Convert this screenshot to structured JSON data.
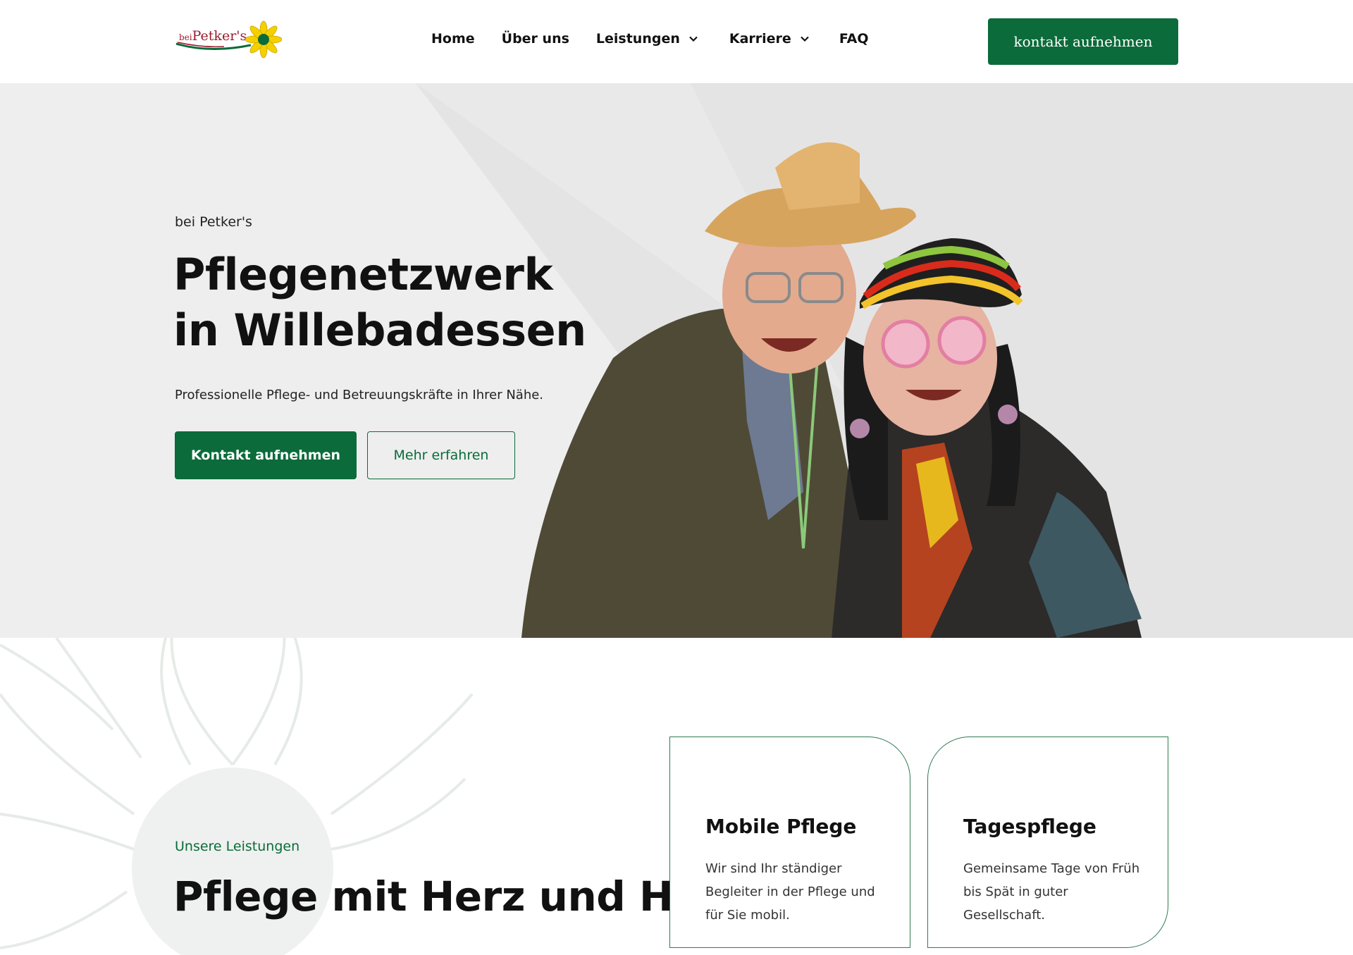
{
  "header": {
    "logo_text": "Petker's",
    "logo_small": "bei",
    "nav": [
      {
        "label": "Home",
        "has_dropdown": false
      },
      {
        "label": "Über uns",
        "has_dropdown": false
      },
      {
        "label": "Leistungen",
        "has_dropdown": true
      },
      {
        "label": "Karriere",
        "has_dropdown": true
      },
      {
        "label": "FAQ",
        "has_dropdown": false
      }
    ],
    "cta_label": "kontakt aufnehmen"
  },
  "hero": {
    "eyebrow": "bei Petker's",
    "title": "Pflegenetzwerk in Willebadessen",
    "subtitle": "Professionelle Pflege- und Betreuungskräfte in Ihrer Nähe.",
    "primary_button": "Kontakt aufnehmen",
    "secondary_button": "Mehr erfahren",
    "photo_icon": "elderly-couple-photo"
  },
  "services": {
    "eyebrow": "Unsere Leistungen",
    "title": "Pflege mit Herz und Hand",
    "cards": [
      {
        "title": "Mobile Pflege",
        "text": "Wir sind Ihr ständiger Begleiter in der Pflege und für Sie mobil."
      },
      {
        "title": "Tagespflege",
        "text": "Gemeinsame Tage von Früh bis Spät in guter Gesellschaft."
      }
    ]
  },
  "colors": {
    "brand_green": "#0b6b3a",
    "logo_red": "#9b1c2c",
    "logo_yellow": "#f5d000",
    "hero_bg": "#eeeeee"
  }
}
